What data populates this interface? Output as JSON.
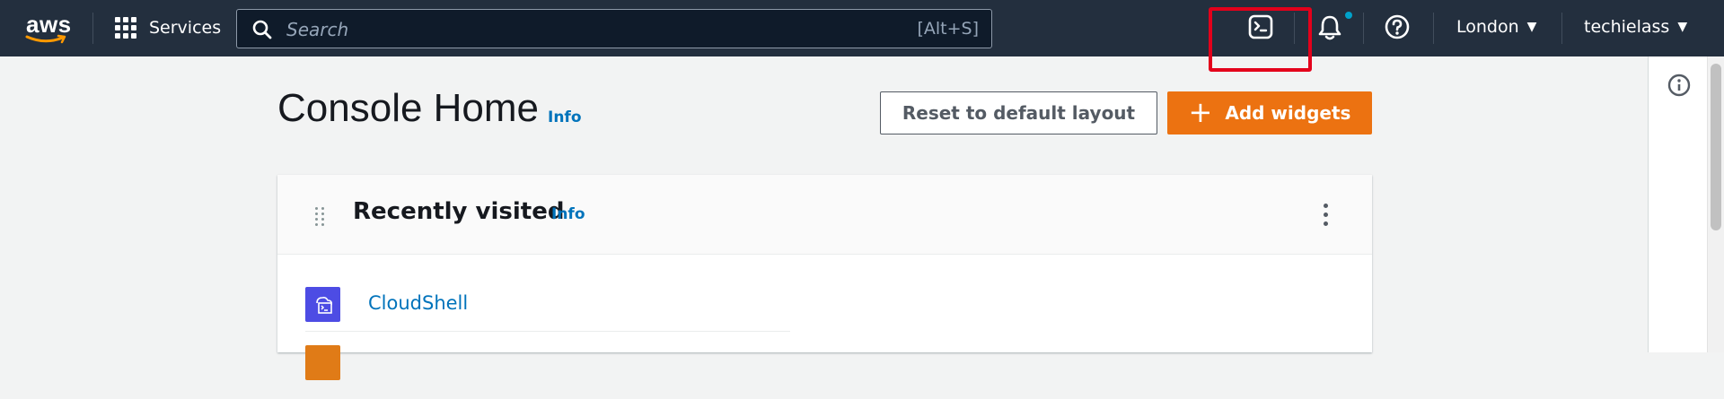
{
  "nav": {
    "logo_text": "aws",
    "services_label": "Services",
    "search": {
      "placeholder": "Search",
      "shortcut": "[Alt+S]"
    },
    "region": "London",
    "account": "techielass",
    "icons": [
      "cloudshell-icon",
      "bell-icon",
      "help-icon"
    ],
    "notification_dot_color": "#00a1c9"
  },
  "page": {
    "title": "Console Home",
    "title_info": "Info",
    "reset_button": "Reset to default layout",
    "add_widgets_button": "Add widgets"
  },
  "recently_visited": {
    "title": "Recently visited",
    "info": "Info",
    "items": [
      {
        "label": "CloudShell",
        "icon": "cloudshell-service-icon",
        "color": "#4d4ce4"
      },
      {
        "label": "",
        "icon": "service-icon",
        "color": "#e07b17"
      }
    ]
  },
  "colors": {
    "nav_bg": "#232f3e",
    "accent": "#ec7211",
    "link": "#0073bb",
    "highlight": "#e3001b"
  }
}
